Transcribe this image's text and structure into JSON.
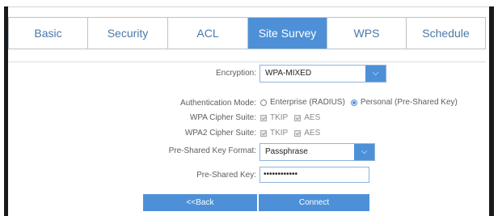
{
  "tabs": [
    {
      "label": "Basic",
      "active": false
    },
    {
      "label": "Security",
      "active": false
    },
    {
      "label": "ACL",
      "active": false
    },
    {
      "label": "Site Survey",
      "active": true
    },
    {
      "label": "WPS",
      "active": false
    },
    {
      "label": "Schedule",
      "active": false
    }
  ],
  "form": {
    "encryption": {
      "label": "Encryption:",
      "value": "WPA-MIXED"
    },
    "auth_mode": {
      "label": "Authentication Mode:",
      "options": [
        {
          "label": "Enterprise (RADIUS)",
          "checked": false
        },
        {
          "label": "Personal (Pre-Shared Key)",
          "checked": true
        }
      ]
    },
    "wpa_cipher": {
      "label": "WPA Cipher Suite:",
      "options": [
        "TKIP",
        "AES"
      ]
    },
    "wpa2_cipher": {
      "label": "WPA2 Cipher Suite:",
      "options": [
        "TKIP",
        "AES"
      ]
    },
    "psk_format": {
      "label": "Pre-Shared Key Format:",
      "value": "Passphrase"
    },
    "psk": {
      "label": "Pre-Shared Key:",
      "value": "••••••••••••"
    }
  },
  "buttons": {
    "back": "<<Back",
    "connect": "Connect"
  },
  "colors": {
    "accent": "#4d90d8",
    "tab_text": "#4a78a8",
    "label": "#5e5e5e"
  }
}
